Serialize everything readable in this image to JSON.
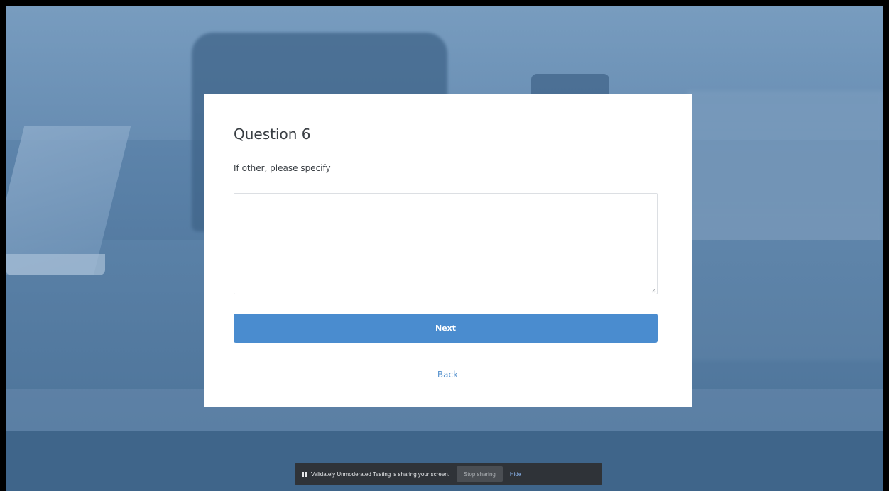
{
  "survey": {
    "question_title": "Question 6",
    "question_prompt": "If other, please specify",
    "answer_value": "",
    "next_label": "Next",
    "back_label": "Back"
  },
  "share_bar": {
    "message": "Validately Unmoderated Testing is sharing your screen.",
    "stop_label": "Stop sharing",
    "hide_label": "Hide"
  },
  "colors": {
    "primary_button": "#4a8ccf",
    "link": "#5b95cf",
    "backdrop": "#5a81a8",
    "share_bar": "#2f3338"
  }
}
